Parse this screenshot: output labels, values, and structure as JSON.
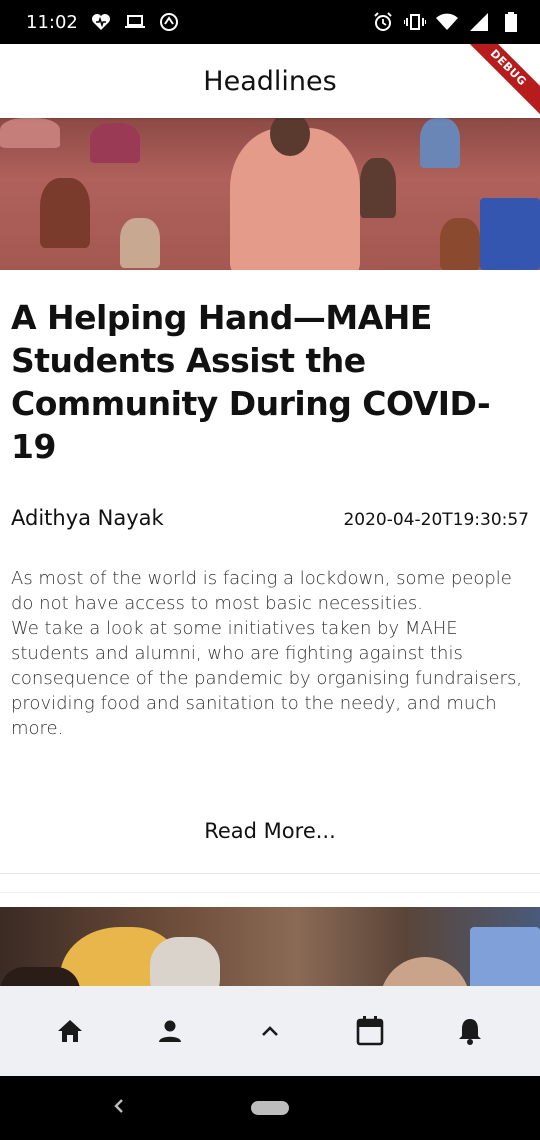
{
  "status_bar": {
    "time": "11:02",
    "icons_left": [
      "heart-icon",
      "laptop-icon",
      "sync-icon"
    ],
    "icons_right": [
      "alarm-icon",
      "vibrate-icon",
      "wifi-icon",
      "signal-icon",
      "battery-icon"
    ]
  },
  "app_bar": {
    "title": "Headlines",
    "debug_label": "DEBUG"
  },
  "articles": [
    {
      "title": "A Helping Hand—MAHE Students Assist the Community During COVID-19",
      "author": "Adithya Nayak",
      "timestamp": "2020-04-20T19:30:57",
      "summary_line1": "As most of the world is facing a lockdown, some people do not have access to most basic necessities.",
      "summary_line2": "We take a look at some initiatives taken by MAHE students and alumni, who are fighting against this consequence of the pandemic by organising fundraisers, providing food and sanitation to the needy, and much more.",
      "read_more": "Read More..."
    }
  ],
  "bottom_nav": [
    "home-icon",
    "person-icon",
    "chevron-up-icon",
    "calendar-icon",
    "bell-icon"
  ],
  "colors": {
    "status_bar_bg": "#000000",
    "debug_ribbon": "#b71c1c",
    "bottom_nav_bg": "#eef0f3"
  }
}
